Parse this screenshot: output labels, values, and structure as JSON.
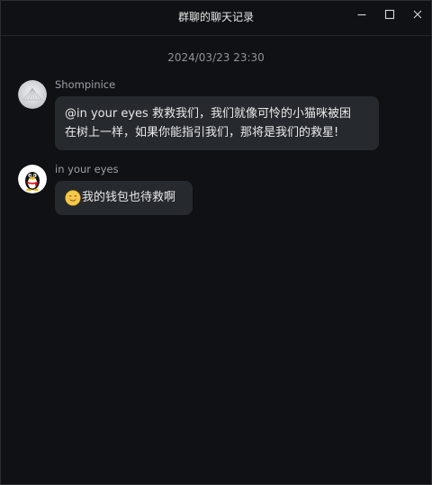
{
  "window": {
    "title": "群聊的聊天记录"
  },
  "controls": {
    "minimize_icon": "minimize-icon",
    "maximize_icon": "maximize-icon",
    "close_icon": "close-icon"
  },
  "chat": {
    "timestamp": "2024/03/23 23:30",
    "messages": [
      {
        "sender": "Shompinice",
        "avatar_icon": "fan-avatar",
        "lines": [
          "@in your eyes 救救我们，我们就像可怜的小猫咪被困",
          "在树上一样，如果你能指引我们，那将是我们的救星!"
        ]
      },
      {
        "sender": "in your eyes",
        "avatar_icon": "qq-penguin-avatar",
        "emoji": "smile-emoji",
        "text": "我的钱包也待救啊"
      }
    ]
  },
  "colors": {
    "background": "#0f1114",
    "bubble": "#26292d",
    "text": "#e9eaeb",
    "muted": "#9ba1a8"
  }
}
